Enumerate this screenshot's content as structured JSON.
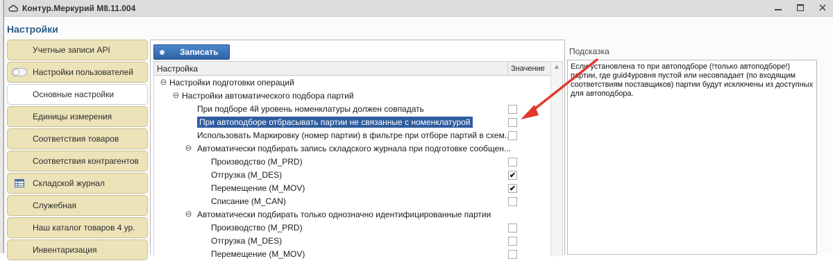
{
  "window": {
    "title": "Контур.Меркурий М8.11.004",
    "heading": "Настройки"
  },
  "sidebar": {
    "items": [
      {
        "label": "Учетные записи API",
        "icon": "none",
        "active": false
      },
      {
        "label": "Настройки пользователей",
        "icon": "toggle-icon",
        "active": false
      },
      {
        "label": "Основные настройки",
        "icon": "none",
        "active": true
      },
      {
        "label": "Единицы измерения",
        "icon": "none",
        "active": false
      },
      {
        "label": "Соответствия товаров",
        "icon": "none",
        "active": false
      },
      {
        "label": "Соответствия контрагентов",
        "icon": "none",
        "active": false
      },
      {
        "label": "Складской журнал",
        "icon": "journal-icon",
        "active": false
      },
      {
        "label": "Служебная",
        "icon": "none",
        "active": false
      },
      {
        "label": "Наш каталог товаров 4 ур.",
        "icon": "none",
        "active": false
      },
      {
        "label": "Инвентаризация",
        "icon": "none",
        "active": false
      }
    ]
  },
  "toolbar": {
    "save_label": "Записать"
  },
  "grid": {
    "col_setting": "Настройка",
    "col_value": "Значение",
    "rows": [
      {
        "text": "Настройки подготовки операций",
        "level": 0,
        "group": true,
        "checkbox": false,
        "checked": false,
        "selected": false
      },
      {
        "text": "Настройки автоматического подбора партий",
        "level": 1,
        "group": true,
        "checkbox": false,
        "checked": false,
        "selected": false
      },
      {
        "text": "При подборе 4й уровень номенклатуры должен совпадать",
        "level": 2,
        "group": false,
        "checkbox": true,
        "checked": false,
        "selected": false
      },
      {
        "text": "При автоподборе отбрасывать партии не связанные с номенклатурой",
        "level": 2,
        "group": false,
        "checkbox": true,
        "checked": false,
        "selected": true
      },
      {
        "text": "Использовать Маркировку (номер партии) в фильтре при отборе партий в схем...",
        "level": 2,
        "group": false,
        "checkbox": true,
        "checked": false,
        "selected": false
      },
      {
        "text": "Автоматически подбирать запись складского журнала при подготовке сообщен...",
        "level": 2,
        "group": true,
        "checkbox": false,
        "checked": false,
        "selected": false
      },
      {
        "text": "Производство (M_PRD)",
        "level": 3,
        "group": false,
        "checkbox": true,
        "checked": false,
        "selected": false
      },
      {
        "text": "Отгрузка (M_DES)",
        "level": 3,
        "group": false,
        "checkbox": true,
        "checked": true,
        "selected": false
      },
      {
        "text": "Перемещение (M_MOV)",
        "level": 3,
        "group": false,
        "checkbox": true,
        "checked": true,
        "selected": false
      },
      {
        "text": "Списание (M_CAN)",
        "level": 3,
        "group": false,
        "checkbox": true,
        "checked": false,
        "selected": false
      },
      {
        "text": "Автоматически подбирать только однозначно идентифицированные партии",
        "level": 2,
        "group": true,
        "checkbox": false,
        "checked": false,
        "selected": false
      },
      {
        "text": "Производство (M_PRD)",
        "level": 3,
        "group": false,
        "checkbox": true,
        "checked": false,
        "selected": false
      },
      {
        "text": "Отгрузка (M_DES)",
        "level": 3,
        "group": false,
        "checkbox": true,
        "checked": false,
        "selected": false
      },
      {
        "text": "Перемещение (M_MOV)",
        "level": 3,
        "group": false,
        "checkbox": true,
        "checked": false,
        "selected": false
      }
    ]
  },
  "hint": {
    "label": "Подсказка",
    "text": "Если установлена то при автоподборе (!только автоподборе!) партии, где guid4уровня пустой или несовпадает (по входящим соответствиям поставщиков) партии будут исключены из доступных для автоподбора."
  },
  "colors": {
    "accent": "#2f5c9e",
    "sidebar_bg": "#ece3b9",
    "heading": "#2a5c8a",
    "annotation_arrow": "#e0382b"
  }
}
